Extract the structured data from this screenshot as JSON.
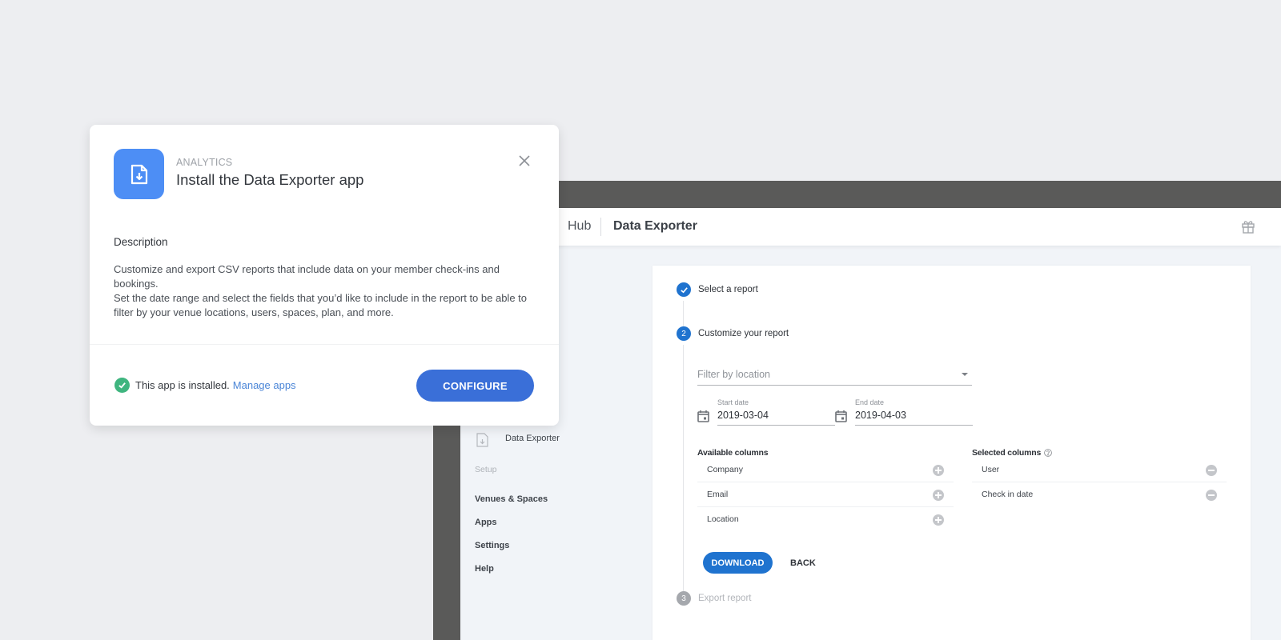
{
  "modal": {
    "category": "ANALYTICS",
    "title": "Install the Data Exporter app",
    "app_icon": "file-download-icon",
    "close_icon": "close-icon",
    "description_heading": "Description",
    "description_paragraphs": [
      "Customize and export CSV reports that include data on your member check-ins and bookings.",
      "Set the date range and select the fields that you’d like to include in the report to be able to filter by your venue locations, users, spaces, plan, and more."
    ],
    "installed_text": "This app is installed.",
    "manage_link": "Manage apps",
    "configure_label": "CONFIGURE",
    "colors": {
      "icon_bg": "#4d8ef5",
      "configure_bg": "#3a6fd8",
      "success": "#3fb57f",
      "link": "#4a85d7"
    }
  },
  "app": {
    "breadcrumb": {
      "previous": "Hub",
      "current": "Data Exporter"
    },
    "header_icon": "gift-icon",
    "sidebar": {
      "active_item": "Data Exporter",
      "section_label": "Setup",
      "links": [
        "Venues & Spaces",
        "Apps",
        "Settings",
        "Help"
      ]
    },
    "steps": [
      {
        "number": "1",
        "label": "Select a report",
        "state": "done"
      },
      {
        "number": "2",
        "label": "Customize your report",
        "state": "active"
      },
      {
        "number": "3",
        "label": "Export report",
        "state": "inactive"
      }
    ],
    "filter": {
      "placeholder": "Filter by location"
    },
    "start_date": {
      "label": "Start date",
      "value": "2019-03-04"
    },
    "end_date": {
      "label": "End date",
      "value": "2019-04-03"
    },
    "available_columns": {
      "title": "Available columns",
      "items": [
        "Company",
        "Email",
        "Location"
      ]
    },
    "selected_columns": {
      "title": "Selected columns",
      "items": [
        "User",
        "Check in date"
      ]
    },
    "download_label": "DOWNLOAD",
    "back_label": "BACK",
    "colors": {
      "primary": "#1f73cf",
      "dark_chrome": "#5a5a59"
    }
  }
}
